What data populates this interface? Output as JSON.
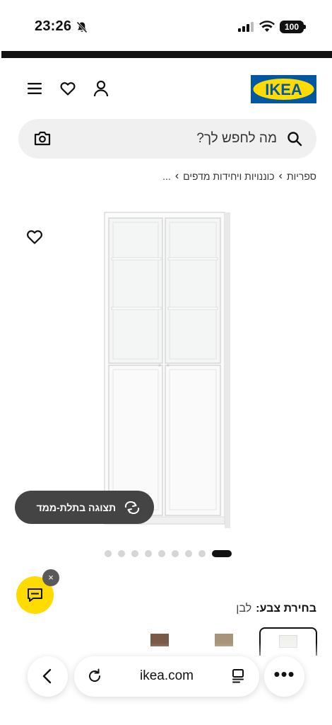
{
  "status_bar": {
    "time": "23:26",
    "battery": "100",
    "icons": [
      "bell-off-icon",
      "signal-icon",
      "wifi-icon",
      "battery-icon"
    ]
  },
  "header": {
    "logo_text": "IKEA",
    "icons": [
      "menu-icon",
      "heart-icon",
      "user-icon"
    ],
    "colors": {
      "logo_blue": "#0058a3",
      "logo_yellow": "#ffdb00"
    }
  },
  "search": {
    "placeholder": "מה לחפש לך?",
    "icons": [
      "camera-icon",
      "search-icon"
    ]
  },
  "breadcrumb": {
    "items": [
      "...",
      "כוננויות ויחידות מדפים",
      "ספריות"
    ],
    "separator": "›"
  },
  "product": {
    "view_3d_label": "תצוגה בתלת-ממד",
    "image_count": 9,
    "active_image": 1
  },
  "chat": {
    "close": "×",
    "accent": "#ffdb00"
  },
  "colour": {
    "label": "בחירת צבע:",
    "value": "לבן"
  },
  "browser": {
    "url": "ikea.com",
    "more": "•••",
    "icons": [
      "back-icon",
      "reload-icon",
      "reader-icon",
      "more-icon"
    ]
  }
}
